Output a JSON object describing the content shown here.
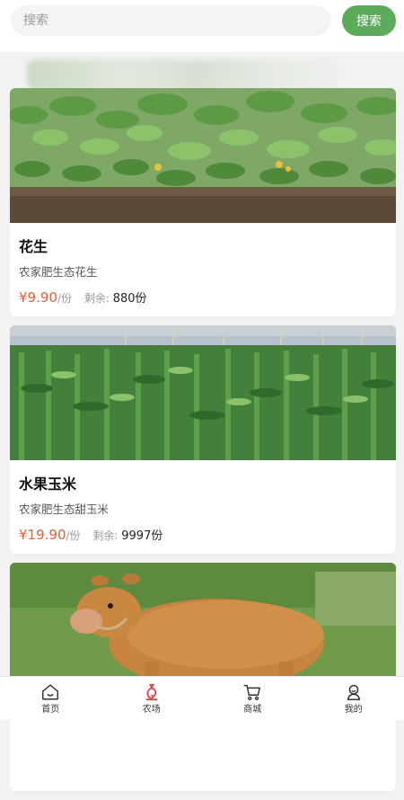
{
  "search": {
    "placeholder": "搜索",
    "button_label": "搜索"
  },
  "products": [
    {
      "name": "花生",
      "description": "农家肥生态花生",
      "price": "¥9.90",
      "unit": "/份",
      "stock_label": "剩余:",
      "stock": "880份"
    },
    {
      "name": "水果玉米",
      "description": "农家肥生态甜玉米",
      "price": "¥19.90",
      "unit": "/份",
      "stock_label": "剩余:",
      "stock": "9997份"
    },
    {
      "name": "",
      "description": "",
      "price": "",
      "unit": "",
      "stock_label": "",
      "stock": ""
    }
  ],
  "tabbar": {
    "items": [
      {
        "label": "首页",
        "icon": "home-icon"
      },
      {
        "label": "农场",
        "icon": "farm-icon",
        "active": true
      },
      {
        "label": "商城",
        "icon": "cart-icon"
      },
      {
        "label": "我的",
        "icon": "profile-icon"
      }
    ]
  },
  "colors": {
    "accent": "#5bab5b",
    "price": "#e0623a",
    "active_tab_icon": "#d93a3a"
  }
}
